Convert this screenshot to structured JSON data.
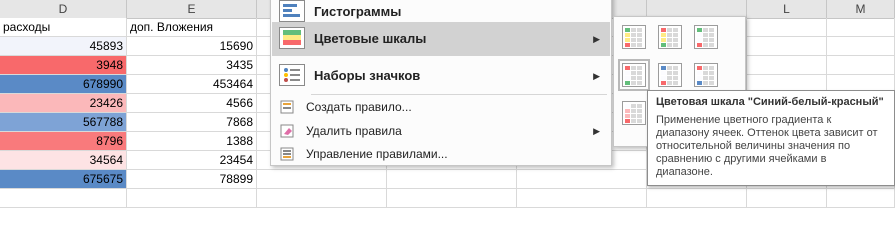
{
  "sheet": {
    "columns": [
      "D",
      "E",
      "",
      "",
      "",
      "",
      "L",
      "M"
    ],
    "rows": [
      {
        "d": "расходы",
        "e": "доп. Вложения",
        "d_bg": "#ffffff"
      },
      {
        "d": "45893",
        "e": "15690",
        "d_bg": "#f2f4fb"
      },
      {
        "d": "3948",
        "e": "3435",
        "d_bg": "#f8696b"
      },
      {
        "d": "678990",
        "e": "453464",
        "d_bg": "#5a8ac6"
      },
      {
        "d": "23426",
        "e": "4566",
        "d_bg": "#fbb8ba"
      },
      {
        "d": "567788",
        "e": "7868",
        "d_bg": "#7ea3d6"
      },
      {
        "d": "8796",
        "e": "1388",
        "d_bg": "#f97a7c"
      },
      {
        "d": "34564",
        "e": "23454",
        "d_bg": "#fde3e4"
      },
      {
        "d": "675675",
        "e": "78899",
        "d_bg": "#5a8ac6"
      },
      {
        "d": "",
        "e": "",
        "d_bg": "#ffffff"
      }
    ]
  },
  "menu": {
    "histograms": "Гистограммы",
    "color_scales": "Цветовые шкалы",
    "icon_sets": "Наборы значков",
    "new_rule": "Создать правило...",
    "clear_rules": "Удалить правила",
    "manage_rules": "Управление правилами...",
    "submenu_arrow": "▶"
  },
  "gallery": {
    "swatches": [
      {
        "name": "scale-green-yellow-red",
        "colors": [
          "#63be7b",
          "#ffeb84",
          "#f8696b"
        ]
      },
      {
        "name": "scale-red-yellow-green",
        "colors": [
          "#f8696b",
          "#ffeb84",
          "#63be7b"
        ]
      },
      {
        "name": "scale-green-white-red",
        "colors": [
          "#63be7b",
          "#fcfcff",
          "#f8696b"
        ]
      },
      {
        "name": "scale-red-white-green",
        "colors": [
          "#f8696b",
          "#fcfcff",
          "#63be7b"
        ]
      },
      {
        "name": "scale-blue-white-red",
        "colors": [
          "#5a8ac6",
          "#fcfcff",
          "#f8696b"
        ]
      },
      {
        "name": "scale-red-white-blue",
        "colors": [
          "#f8696b",
          "#fcfcff",
          "#5a8ac6"
        ]
      },
      {
        "name": "scale-white-red",
        "colors": [
          "#fcfcff",
          "#fcb9bb",
          "#f8696b"
        ]
      },
      {
        "name": "scale-red-white",
        "colors": [
          "#f8696b",
          "#fcb9bb",
          "#fcfcff"
        ]
      },
      {
        "name": "scale-green-white",
        "colors": [
          "#63be7b",
          "#b1dfbd",
          "#fcfcff"
        ]
      }
    ]
  },
  "tooltip": {
    "title": "Цветовая шкала \"Синий-белый-красный\"",
    "body": "Применение цветного градиента к диапазону ячеек. Оттенок цвета зависит от относительной величины значения по сравнению с другими ячейками в диапазоне."
  }
}
